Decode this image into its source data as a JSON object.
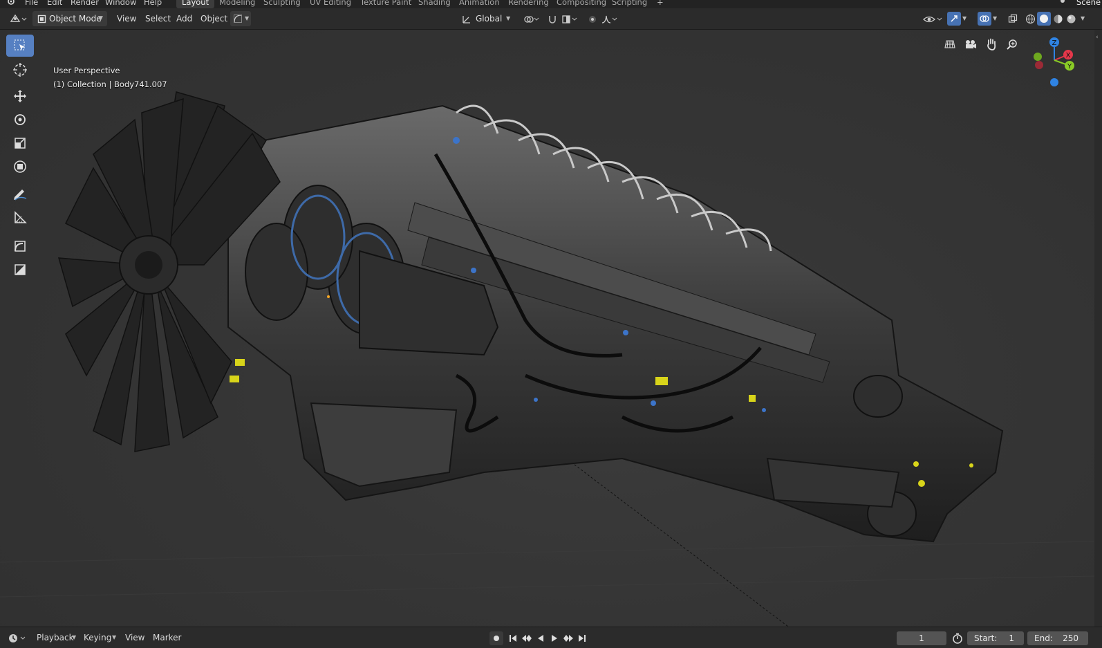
{
  "menubar": {
    "items": [
      "File",
      "Edit",
      "Render",
      "Window",
      "Help"
    ],
    "workspaces": [
      "Layout",
      "Modeling",
      "Sculpting",
      "UV Editing",
      "Texture Paint",
      "Shading",
      "Animation",
      "Rendering",
      "Compositing",
      "Scripting"
    ],
    "active_workspace": "Layout",
    "add_tab": "+",
    "scene_label": "Scene"
  },
  "header": {
    "mode": "Object Mode",
    "menus": [
      "View",
      "Select",
      "Add",
      "Object"
    ],
    "transform_orientation": "Global"
  },
  "viewport": {
    "perspective_label": "User Perspective",
    "collection_label": "(1) Collection | Body741.007"
  },
  "gizmo": {
    "x": "X",
    "y": "Y",
    "z": "Z"
  },
  "timeline": {
    "menus": [
      "Playback",
      "Keying",
      "View",
      "Marker"
    ],
    "current_frame": "1",
    "start_label": "Start:",
    "start_value": "1",
    "end_label": "End:",
    "end_value": "250"
  },
  "colors": {
    "accent": "#5680c2",
    "header_bg": "#2b2b2b",
    "viewport_bg": "#353535",
    "axis_x": "#e5374a",
    "axis_y": "#8acb26",
    "axis_z": "#2f83e3"
  },
  "icons": {
    "toolbar": [
      "select-box-icon",
      "cursor-icon",
      "move-icon",
      "rotate-icon",
      "scale-icon",
      "transform-icon",
      "annotate-icon",
      "measure-icon",
      "add-cube-icon",
      "add-plane-icon"
    ],
    "nav": [
      "grid-toggle-icon",
      "camera-view-icon",
      "hand-pan-icon",
      "zoom-icon"
    ]
  }
}
